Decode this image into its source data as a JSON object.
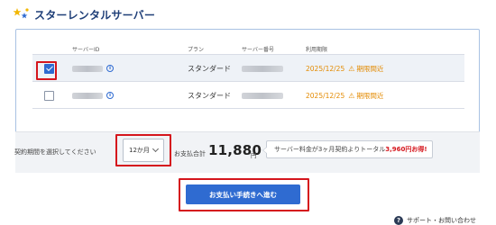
{
  "brand": {
    "name": "スターレンタルサーバー",
    "logo_icon": "star-logo-icon"
  },
  "table": {
    "headers": {
      "server_id": "サーバーID",
      "plan": "プラン",
      "server_number": "サーバー番号",
      "expiry": "利用期限"
    },
    "rows": [
      {
        "selected": true,
        "plan": "スタンダード",
        "expiry": "2025/12/25",
        "warning": "期限間近"
      },
      {
        "selected": false,
        "plan": "スタンダード",
        "expiry": "2025/12/25",
        "warning": "期限間近"
      }
    ]
  },
  "payment": {
    "period_label": "契約期間を選択してください",
    "period_selected": "12か月",
    "total_label": "お支払合計",
    "total_amount": "11,880",
    "currency": "円",
    "promo_text": "サーバー料金が3ヶ月契約よりトータル",
    "promo_strong": "3,960円お得!"
  },
  "cta_label": "お支払い手続きへ進む",
  "support_label": "サポート・お問い合わせ",
  "colors": {
    "accent": "#2f6bd1",
    "warning": "#e38a00",
    "highlight": "#d5161d",
    "brand": "#1f3f78"
  }
}
